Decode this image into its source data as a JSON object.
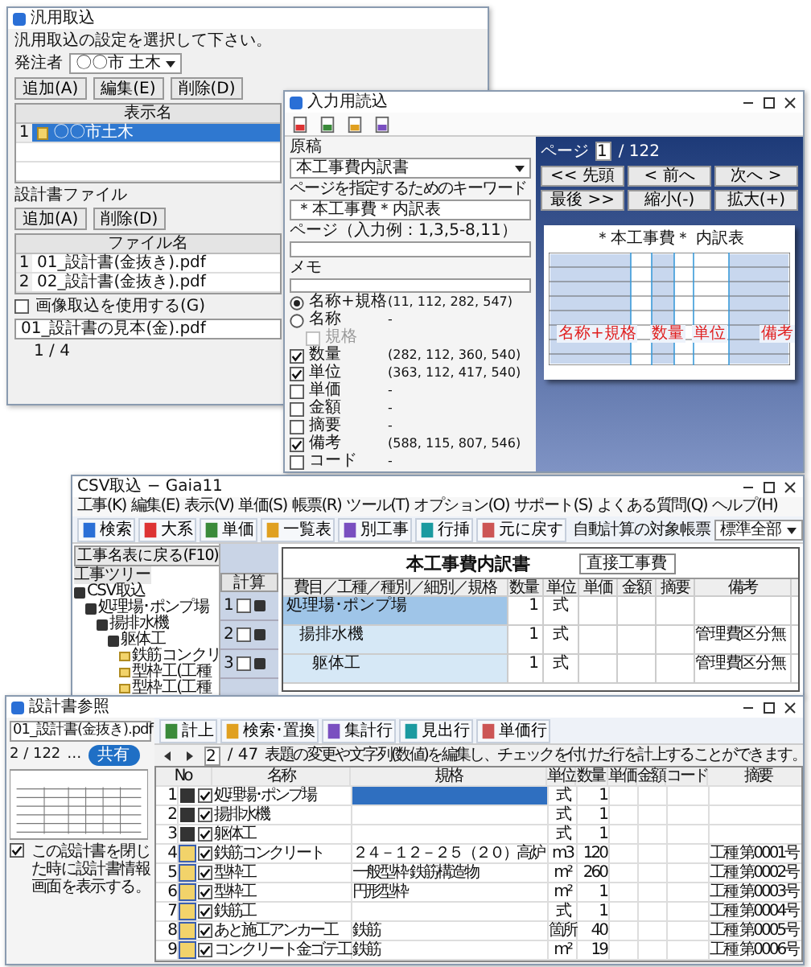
{
  "main_window": {
    "title": "汎用取込",
    "instruction": "汎用取込の設定を選択して下さい。",
    "orderer_label": "発注者",
    "orderer_value": "〇〇市 土木",
    "buttons": [
      "追加(A)",
      "編集(E)",
      "削除(D)"
    ],
    "list_header": "表示名",
    "list_rows": [
      {
        "number": "1",
        "name": "〇〇市土木",
        "selected": true
      }
    ],
    "file_label": "設計書ファイル",
    "file_buttons": [
      "追加(A)",
      "削除(D)"
    ],
    "file_header": "ファイル名",
    "files": [
      {
        "number": "1",
        "name": "01_設計書(金抜き).pdf"
      },
      {
        "number": "2",
        "name": "02_設計書(金抜き).pdf"
      }
    ],
    "image_option": {
      "label": "画像取込を使用する(G)",
      "checked": false
    },
    "path": "01_設計書の見本(金).pdf",
    "page_reading": "1 / 4"
  },
  "reader_window": {
    "title": "入力用読込",
    "source_label": "原稿",
    "source_value": "本工事費内訳書",
    "keyword_label": "ページを指定するためのキーワード",
    "keyword_value": "＊本工事費＊内訳表",
    "page_label": "ページ（入力例：1,3,5-8,11）",
    "memo_label": "メモ",
    "options": [
      {
        "kind": "radio",
        "label": "名称+規格",
        "coords": "(11, 112, 282, 547)",
        "selected": true,
        "disabled": false
      },
      {
        "kind": "radio",
        "label": "名称",
        "coords": "-",
        "selected": false,
        "disabled": false
      },
      {
        "kind": "subcheck",
        "label": "規格",
        "selected": false,
        "disabled": true
      },
      {
        "kind": "check",
        "label": "数量",
        "coords": "(282, 112, 360, 540)",
        "selected": true,
        "disabled": false
      },
      {
        "kind": "check",
        "label": "単位",
        "coords": "(363, 112, 417, 540)",
        "selected": true,
        "disabled": false
      },
      {
        "kind": "check",
        "label": "単価",
        "coords": "-",
        "selected": false,
        "disabled": false
      },
      {
        "kind": "check",
        "label": "金額",
        "coords": "-",
        "selected": false,
        "disabled": false
      },
      {
        "kind": "check",
        "label": "摘要",
        "coords": "-",
        "selected": false,
        "disabled": false
      },
      {
        "kind": "check",
        "label": "備考",
        "coords": "(588, 115, 807, 546)",
        "selected": true,
        "disabled": false
      },
      {
        "kind": "check",
        "label": "コード",
        "coords": "-",
        "selected": false,
        "disabled": false
      }
    ],
    "page_label_right": "ページ",
    "page_value": "1",
    "page_total": "/ 122",
    "nav_buttons": [
      "<< 先頭",
      "< 前へ",
      "次へ >",
      "最後 >>",
      "縮小(-)",
      "拡大(+)"
    ],
    "preview_title": "＊本工事費＊ 内訳表",
    "preview_marks": [
      {
        "label": "名称+規格"
      },
      {
        "label": "数量"
      },
      {
        "label": "単位"
      },
      {
        "label": "備考"
      }
    ]
  },
  "csv_window": {
    "title": "CSV取込 − Gaia11",
    "menu": [
      "工事(K)",
      "編集(E)",
      "表示(V)",
      "単価(S)",
      "帳票(R)",
      "ツール(T)",
      "オプション(O)",
      "サポート(S)",
      "よくある質問(Q)",
      "ヘルプ(H)"
    ],
    "toolbar": [
      "検索",
      "大系",
      "単価",
      "一覧表",
      "別工事",
      "行挿",
      "元に戻す"
    ],
    "auto_calc_label": "自動計算の対象帳票",
    "auto_calc_value": "標準全部",
    "back_button": "工事名表に戻る(F10)",
    "tree_label": "工事ツリー",
    "tree": [
      {
        "label": "CSV取込",
        "children": [
          {
            "label": "処理場･ポンプ場",
            "children": [
              {
                "label": "揚排水機",
                "children": [
                  {
                    "label": "躯体工",
                    "children": [
                      {
                        "label": "鉄筋コンクリ"
                      },
                      {
                        "label": "型枠工(工種"
                      },
                      {
                        "label": "型枠工(工種"
                      }
                    ]
                  }
                ]
              }
            ]
          }
        ]
      }
    ],
    "doc_title": "本工事費内訳書",
    "doc_badge": "直接工事費",
    "calc_header": "計算",
    "columns": [
      "費目／工種／種別／細別／規格",
      "数量",
      "単位",
      "単価",
      "金額",
      "摘要",
      "備考"
    ],
    "rows": [
      {
        "number": "1",
        "checked": false,
        "name": "処理場･ポンプ場",
        "quantity": "1",
        "unit": "式",
        "selected": true
      },
      {
        "number": "2",
        "checked": false,
        "name": "揚排水機",
        "quantity": "1",
        "unit": "式",
        "note": "管理費区分無",
        "selected": false
      },
      {
        "number": "3",
        "checked": false,
        "name": "躯体工",
        "quantity": "1",
        "unit": "式",
        "note": "管理費区分無",
        "selected": false
      }
    ]
  },
  "design_window": {
    "title": "設計書参照",
    "file_value": "01_設計書(金抜き).pdf",
    "page_reading": "2 / 122",
    "more": "…",
    "share_button": "共有",
    "close_option": {
      "label": "この設計書を閉じた時に設計書情報画面を表示する。",
      "checked": true
    },
    "toolbar": [
      "計上",
      "検索･置換",
      "集計行",
      "見出行",
      "単価行"
    ],
    "page_value": "2",
    "page_total": "/ 47",
    "hint": "表題の変更や文字列(数値)を編集し、チェックを付けた行を計上することができます。",
    "columns": [
      "No",
      "名称",
      "規格",
      "単位",
      "数量",
      "単価",
      "金額",
      "コード",
      "摘要"
    ],
    "rows": [
      {
        "number": "1",
        "kind": "summary",
        "checked": true,
        "selected": true,
        "name": "処理場･ポンプ場",
        "unit": "式",
        "quantity": "1"
      },
      {
        "number": "2",
        "kind": "summary",
        "checked": true,
        "selected": false,
        "name": "揚排水機",
        "unit": "式",
        "quantity": "1"
      },
      {
        "number": "3",
        "kind": "summary",
        "checked": true,
        "selected": false,
        "name": "躯体工",
        "unit": "式",
        "quantity": "1"
      },
      {
        "number": "4",
        "kind": "item",
        "checked": true,
        "selected": false,
        "name": "鉄筋コンクリート",
        "spec": "２４－１２－２５（２０）高炉",
        "unit": "m3",
        "quantity": "120",
        "note": "工種 第0001号"
      },
      {
        "number": "5",
        "kind": "item",
        "checked": true,
        "selected": false,
        "name": "型枠工",
        "spec": "一般型枠 鉄筋構造物",
        "unit": "m²",
        "quantity": "260",
        "note": "工種 第0002号"
      },
      {
        "number": "6",
        "kind": "item",
        "checked": true,
        "selected": false,
        "name": "型枠工",
        "spec": "円形型枠",
        "unit": "m²",
        "quantity": "1",
        "note": "工種 第0003号"
      },
      {
        "number": "7",
        "kind": "item",
        "checked": true,
        "selected": false,
        "name": "鉄筋工",
        "unit": "式",
        "quantity": "1",
        "note": "工種 第0004号"
      },
      {
        "number": "8",
        "kind": "item",
        "checked": true,
        "selected": false,
        "name": "あと施工アンカー工",
        "spec": "鉄筋",
        "unit": "箇所",
        "quantity": "40",
        "note": "工種 第0005号"
      },
      {
        "number": "9",
        "kind": "item",
        "checked": true,
        "selected": false,
        "name": "コンクリート金ゴテ工",
        "spec": "鉄筋",
        "unit": "m²",
        "quantity": "19",
        "note": "工種 第0006号"
      }
    ]
  }
}
